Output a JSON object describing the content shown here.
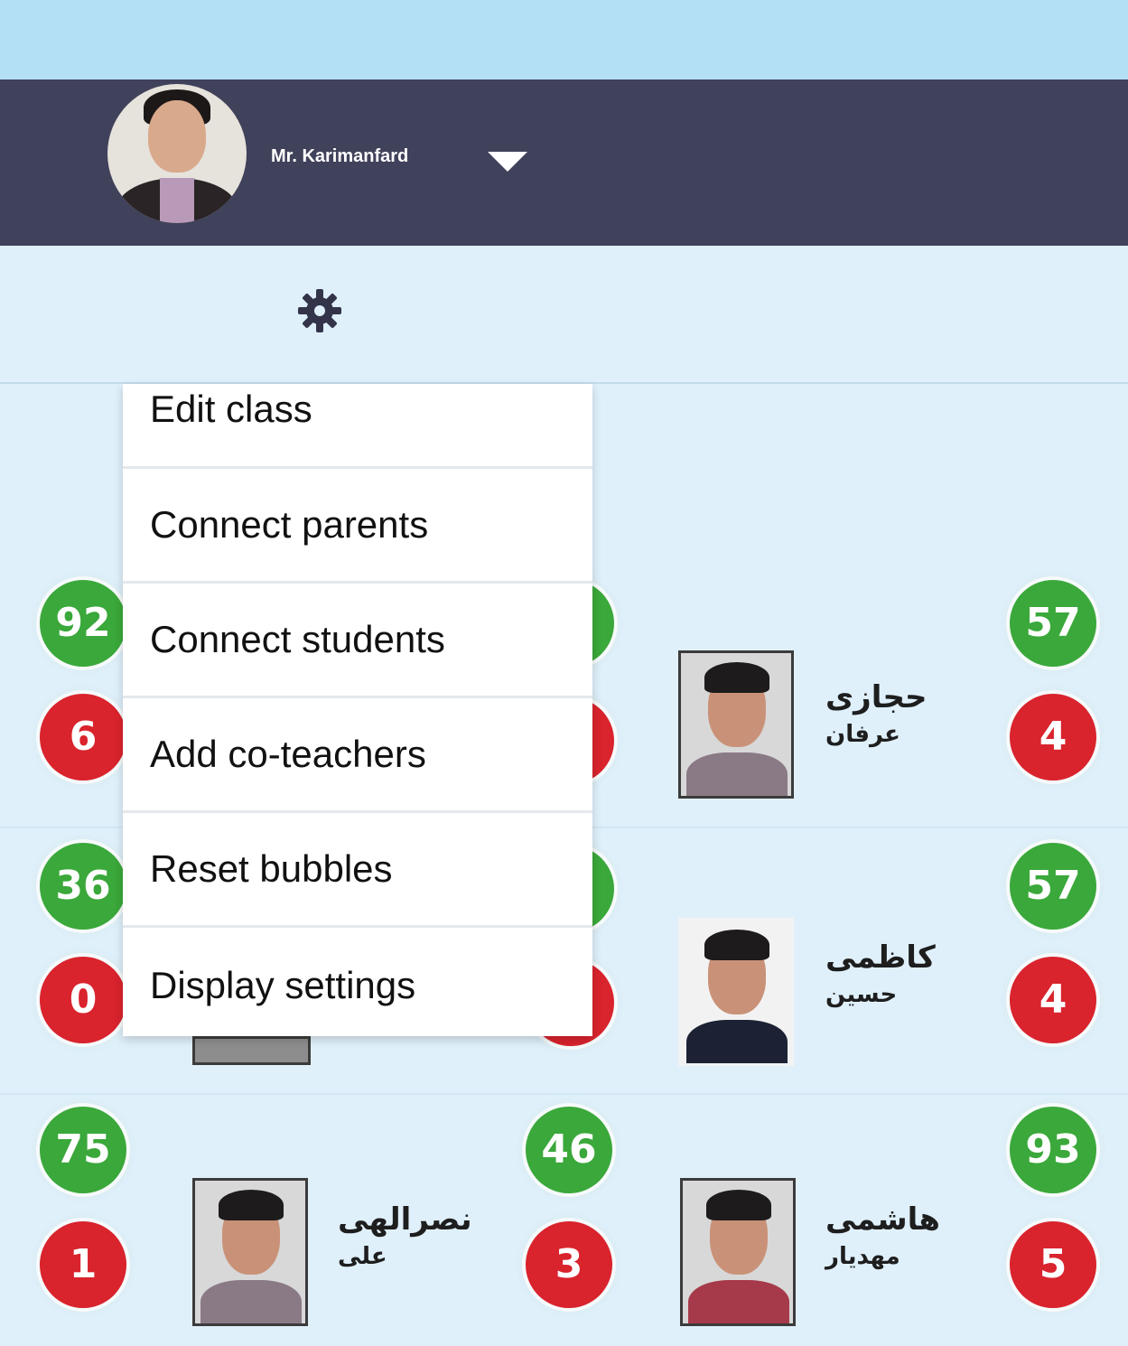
{
  "header": {
    "user_name": "Mr. Karimanfard",
    "icons": {
      "dropdown": "chevron-down-icon",
      "settings": "gear-icon"
    }
  },
  "colors": {
    "header_bg": "#40415a",
    "top_strip": "#b4e0f6",
    "page_bg": "#dff0fb",
    "positive": "#3aa83a",
    "negative": "#d9232d"
  },
  "menu": {
    "items": [
      "Edit class",
      "Connect parents",
      "Connect students",
      "Add co-teachers",
      "Reset bubbles",
      "Display settings"
    ]
  },
  "students": [
    {
      "positive": "92",
      "negative": "6"
    },
    {
      "positive": "57",
      "negative": "4",
      "first_name": "حجازی",
      "last_name": "عرفان"
    },
    {
      "positive": "36",
      "negative": "0"
    },
    {
      "positive": "57",
      "negative": "4",
      "first_name": "کاظمی",
      "last_name": "حسین"
    },
    {
      "positive": "75",
      "negative": "1",
      "first_name": "نصرالهی",
      "last_name": "علی"
    },
    {
      "positive": "46",
      "negative": "3"
    },
    {
      "positive": "93",
      "negative": "5",
      "first_name": "هاشمی",
      "last_name": "مهدیار"
    }
  ]
}
